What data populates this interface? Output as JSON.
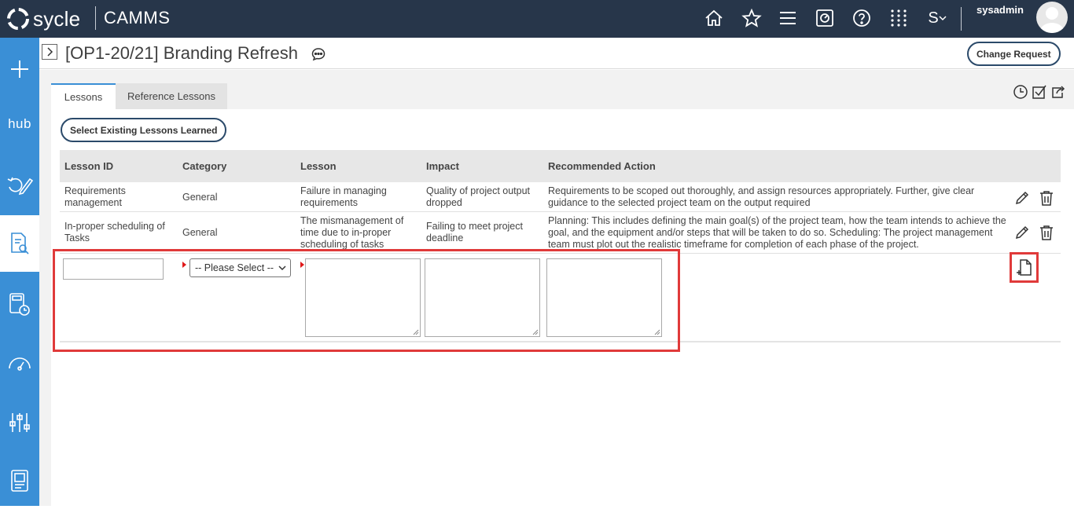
{
  "topbar": {
    "logo_text": "sycle",
    "app_name": "CAMMS",
    "icons": [
      "home-icon",
      "star-icon",
      "menu-icon",
      "dashboard-icon",
      "help-icon",
      "apps-grid-icon",
      "language-icon"
    ],
    "language_label": "S",
    "user_name": "sysadmin"
  },
  "sidebar": {
    "items": [
      "add-icon",
      "hub-icon",
      "edit-cycle-icon",
      "document-search-icon",
      "calculator-clock-icon",
      "gauge-icon",
      "sliders-icon",
      "report-icon"
    ],
    "hub_label": "hub"
  },
  "header": {
    "title": "[OP1-20/21] Branding Refresh",
    "change_request_label": "Change Request"
  },
  "tabs": [
    {
      "label": "Lessons",
      "active": true
    },
    {
      "label": "Reference Lessons",
      "active": false
    }
  ],
  "toolbar": {
    "icons": [
      "history-icon",
      "checkbox-icon",
      "share-icon"
    ]
  },
  "select_existing_label": "Select Existing Lessons Learned",
  "table": {
    "columns": [
      "Lesson ID",
      "Category",
      "Lesson",
      "Impact",
      "Recommended Action"
    ],
    "rows": [
      {
        "lesson_id": "Requirements management",
        "category": "General",
        "lesson": "Failure in managing requirements",
        "impact": "Quality of project output dropped",
        "action": "Requirements to be scoped out thoroughly, and assign resources appropriately. Further, give clear guidance to the selected project team on the output required"
      },
      {
        "lesson_id": "In-proper scheduling of Tasks",
        "category": "General",
        "lesson": "The mismanagement of time due to in-proper scheduling of tasks",
        "impact": "Failing to meet project deadline",
        "action": "Planning: This includes defining the main goal(s) of the project team, how the team intends to achieve the goal, and the equipment and/or steps that will be taken to do so. Scheduling: The project management team must plot out the realistic timeframe for completion of each phase of the project."
      }
    ]
  },
  "new_row": {
    "lesson_id_value": "",
    "category_selected": "-- Please Select --",
    "lesson_value": "",
    "impact_value": "",
    "action_value": ""
  },
  "colors": {
    "topbar": "#27364a",
    "sidebar": "#3a8fd6",
    "highlight": "#e03a3a",
    "required_marker": "#e0191a"
  }
}
